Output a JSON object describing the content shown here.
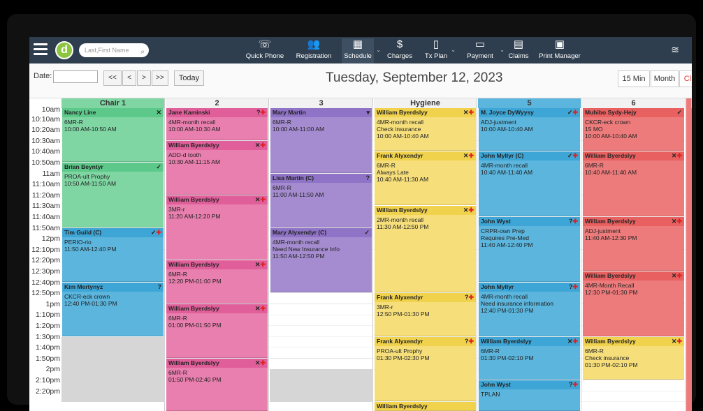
{
  "nav": {
    "search_placeholder": "Last,First Name",
    "logo_letter": "d",
    "items": [
      {
        "label": "Quick Phone",
        "icon": "phone-icon",
        "glyph": "☏"
      },
      {
        "label": "Registration",
        "icon": "people-icon",
        "glyph": "👥"
      },
      {
        "label": "Schedule",
        "icon": "calendar-icon",
        "glyph": "▦"
      },
      {
        "label": "Charges",
        "icon": "dollar-icon",
        "glyph": "$"
      },
      {
        "label": "Tx Plan",
        "icon": "tooth-icon",
        "glyph": "▯"
      },
      {
        "label": "Payment",
        "icon": "money-icon",
        "glyph": "▭"
      },
      {
        "label": "Claims",
        "icon": "claims-icon",
        "glyph": "▤"
      },
      {
        "label": "Print Manager",
        "icon": "print-icon",
        "glyph": "▣"
      }
    ]
  },
  "toolbar": {
    "date_label": "Date:",
    "btn_first": "<<",
    "btn_prev": "<",
    "btn_next": ">",
    "btn_last": ">>",
    "today": "Today",
    "current_date": "Tuesday, September 12, 2023",
    "view_15": "15 Min",
    "view_month": "Month",
    "view_cl": "Cl"
  },
  "columns": [
    "Chair 1",
    "2",
    "3",
    "Hygiene",
    "5",
    "6"
  ],
  "times": [
    "10am",
    "10:10am",
    "10:20am",
    "10:30am",
    "10:40am",
    "10:50am",
    "11am",
    "11:10am",
    "11:20am",
    "11:30am",
    "11:40am",
    "11:50am",
    "12pm",
    "12:10pm",
    "12:20pm",
    "12:30pm",
    "12:40pm",
    "12:50pm",
    "1pm",
    "1:10pm",
    "1:20pm",
    "1:30pm",
    "1:40pm",
    "1:50pm",
    "2pm",
    "2:10pm",
    "2:20pm"
  ],
  "appointments": [
    {
      "col": 0,
      "start": 0,
      "rows": 5,
      "color": "green",
      "name": "Nancy Line",
      "status": "x",
      "lines": [
        "6MR-R",
        "10:00 AM-10:50 AM"
      ]
    },
    {
      "col": 0,
      "start": 5,
      "rows": 6,
      "color": "green",
      "name": "Brian Beyntyr",
      "status": "chk",
      "lines": [
        "PROA-ult Prophy",
        "10:50 AM-11:50 AM"
      ]
    },
    {
      "col": 0,
      "start": 11,
      "rows": 5,
      "color": "blue",
      "name": "Tim Guild (C)",
      "status": "chkplus",
      "lines": [
        "PERIO-rio",
        "11:50 AM-12:40 PM"
      ]
    },
    {
      "col": 0,
      "start": 16,
      "rows": 5,
      "color": "blue",
      "name": "Kim Mertynyz",
      "status": "q",
      "lines": [
        "CKCR-eck crown",
        "12:40 PM-01:30 PM"
      ]
    },
    {
      "col": 1,
      "start": 0,
      "rows": 3,
      "color": "pink",
      "name": "Jane Kaminski",
      "status": "qplus",
      "lines": [
        "4MR-month recall",
        "10:00 AM-10:30 AM"
      ]
    },
    {
      "col": 1,
      "start": 3,
      "rows": 5,
      "color": "pink",
      "name": "William Byerdslyy",
      "status": "xplus",
      "lines": [
        "ADD-d tooth",
        "10:30 AM-11:15 AM"
      ]
    },
    {
      "col": 1,
      "start": 8,
      "rows": 6,
      "color": "pink",
      "name": "William Byerdslyy",
      "status": "xplus",
      "lines": [
        "3MR-r",
        "11:20 AM-12:20 PM"
      ]
    },
    {
      "col": 1,
      "start": 14,
      "rows": 4,
      "color": "pink",
      "name": "William Byerdslyy",
      "status": "xplus",
      "lines": [
        "6MR-R",
        "12:20 PM-01:00 PM"
      ]
    },
    {
      "col": 1,
      "start": 18,
      "rows": 5,
      "color": "pink",
      "name": "William Byerdslyy",
      "status": "xplus",
      "lines": [
        "6MR-R",
        "01:00 PM-01:50 PM"
      ]
    },
    {
      "col": 1,
      "start": 23,
      "rows": 5,
      "color": "pink",
      "name": "William Byerdslyy",
      "status": "xplus",
      "lines": [
        "6MR-R",
        "01:50 PM-02:40 PM"
      ]
    },
    {
      "col": 2,
      "start": 0,
      "rows": 6,
      "color": "purple",
      "name": "Mary Martin",
      "status": "tooth",
      "lines": [
        "6MR-R",
        "10:00 AM-11:00 AM"
      ]
    },
    {
      "col": 2,
      "start": 6,
      "rows": 5,
      "color": "purple",
      "name": "Lisa Martin (C)",
      "status": "q",
      "lines": [
        "6MR-R",
        "11:00 AM-11:50 AM"
      ]
    },
    {
      "col": 2,
      "start": 11,
      "rows": 6,
      "color": "purple",
      "name": "Mary Alyxendyr (C)",
      "status": "chk",
      "lines": [
        "4MR-month recall",
        "Need New Insurance Info",
        "11:50 AM-12:50 PM"
      ]
    },
    {
      "col": 3,
      "start": 0,
      "rows": 4,
      "color": "yellow",
      "name": "William Byerdslyy",
      "status": "xplus",
      "lines": [
        "4MR-month recall",
        "Check insurance",
        "10:00 AM-10:40 AM"
      ]
    },
    {
      "col": 3,
      "start": 4,
      "rows": 5,
      "color": "yellow",
      "name": "Frank Alyxendyr",
      "status": "xplus",
      "lines": [
        "6MR-R",
        "Always Late",
        "10:40 AM-11:30 AM"
      ]
    },
    {
      "col": 3,
      "start": 9,
      "rows": 8,
      "color": "yellow",
      "name": "William Byerdslyy",
      "status": "xplus",
      "lines": [
        "2MR-month recall",
        "11:30 AM-12:50 PM"
      ]
    },
    {
      "col": 3,
      "start": 17,
      "rows": 4,
      "color": "yellow",
      "name": "Frank Alyxendyr",
      "status": "qplus",
      "lines": [
        "3MR-r",
        "12:50 PM-01:30 PM"
      ]
    },
    {
      "col": 3,
      "start": 21,
      "rows": 6,
      "color": "yellow",
      "name": "Frank Alyxendyr",
      "status": "qplus",
      "lines": [
        "PROA-ult Prophy",
        "01:30 PM-02:30 PM"
      ]
    },
    {
      "col": 3,
      "start": 27,
      "rows": 1,
      "color": "yellow",
      "name": "William Byerdslyy",
      "status": "",
      "lines": []
    },
    {
      "col": 4,
      "start": 0,
      "rows": 4,
      "color": "blue",
      "name": "M. Joyce DyWyysy",
      "status": "chkplus",
      "lines": [
        "ADJ-justment",
        "10:00 AM-10:40 AM"
      ]
    },
    {
      "col": 4,
      "start": 4,
      "rows": 6,
      "color": "blue",
      "name": "John Myllyr (C)",
      "status": "chkplus",
      "lines": [
        "4MR-month recall",
        "10:40 AM-11:40 AM"
      ]
    },
    {
      "col": 4,
      "start": 10,
      "rows": 6,
      "color": "blue",
      "name": "John Wyst",
      "status": "qplus",
      "lines": [
        "CRPR-own Prep",
        "Requires Pre-Med",
        "11:40 AM-12:40 PM"
      ]
    },
    {
      "col": 4,
      "start": 16,
      "rows": 5,
      "color": "blue",
      "name": "John Myllyr",
      "status": "qplus",
      "lines": [
        "4MR-month recall",
        "Need insurance information",
        "12:40 PM-01:30 PM"
      ]
    },
    {
      "col": 4,
      "start": 21,
      "rows": 4,
      "color": "blue",
      "name": "William Byerdslyy",
      "status": "xplus",
      "lines": [
        "6MR-R",
        "01:30 PM-02:10 PM"
      ]
    },
    {
      "col": 4,
      "start": 25,
      "rows": 3,
      "color": "blue",
      "name": "John Wyst",
      "status": "qplus",
      "lines": [
        "TPLAN"
      ]
    },
    {
      "col": 5,
      "start": 0,
      "rows": 4,
      "color": "salmon",
      "name": "Muhibo Sydy-Hejy",
      "status": "chk",
      "lines": [
        "CKCR-eck crown",
        "15 MO",
        "10:00 AM-10:40 AM"
      ]
    },
    {
      "col": 5,
      "start": 4,
      "rows": 6,
      "color": "salmon",
      "name": "William Byerdslyy",
      "status": "xplus",
      "lines": [
        "6MR-R",
        "10:40 AM-11:40 AM"
      ]
    },
    {
      "col": 5,
      "start": 10,
      "rows": 5,
      "color": "salmon",
      "name": "William Byerdslyy",
      "status": "xplus",
      "lines": [
        "ADJ-justment",
        "11:40 AM-12:30 PM"
      ]
    },
    {
      "col": 5,
      "start": 15,
      "rows": 6,
      "color": "salmon",
      "name": "William Byerdslyy",
      "status": "xplus",
      "lines": [
        "4MR-Month Recall",
        "12:30 PM-01:30 PM"
      ]
    },
    {
      "col": 5,
      "start": 21,
      "rows": 4,
      "color": "yellow",
      "name": "William Byerdslyy",
      "status": "xplus",
      "lines": [
        "6MR-R",
        "Check insurance",
        "01:30 PM-02:10 PM"
      ]
    }
  ]
}
